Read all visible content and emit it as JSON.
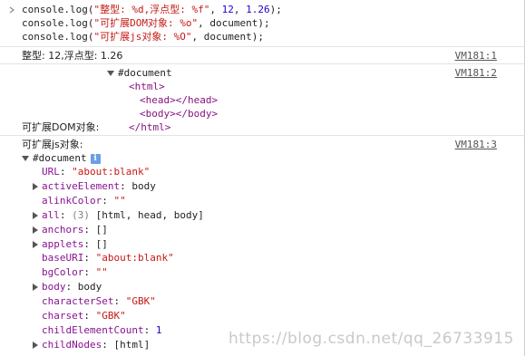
{
  "code": {
    "lines": [
      {
        "pre": "console.log(",
        "str": "\"整型: %d,浮点型: %f\"",
        "mid": ", ",
        "arg1": "12",
        "sep": ", ",
        "arg2": "1.26",
        "end": ");"
      },
      {
        "pre": "console.log(",
        "str": "\"可扩展DOM对象: %o\"",
        "rest": ", document);"
      },
      {
        "pre": "console.log(",
        "str": "\"可扩展js对象: %O\"",
        "rest": ", document);"
      }
    ]
  },
  "output1": {
    "text": "整型: 12,浮点型: 1.26",
    "source": "VM181:1"
  },
  "output2": {
    "label": "可扩展DOM对象:",
    "source": "VM181:2",
    "node": "#document",
    "tree": [
      "<html>",
      "<head></head>",
      "<body></body>",
      "</html>"
    ]
  },
  "output3": {
    "label": "可扩展js对象:",
    "source": "VM181:3",
    "node": "#document",
    "info_icon": "i",
    "props": [
      {
        "key": "URL",
        "value": "\"about:blank\"",
        "kind": "str",
        "expandable": false
      },
      {
        "key": "activeElement",
        "value": "body",
        "kind": "plain",
        "expandable": true
      },
      {
        "key": "alinkColor",
        "value": "\"\"",
        "kind": "str",
        "expandable": false
      },
      {
        "key": "all",
        "value": "(3) [html, head, body]",
        "kind": "plain",
        "expandable": true
      },
      {
        "key": "anchors",
        "value": "[]",
        "kind": "plain",
        "expandable": true
      },
      {
        "key": "applets",
        "value": "[]",
        "kind": "plain",
        "expandable": true
      },
      {
        "key": "baseURI",
        "value": "\"about:blank\"",
        "kind": "str",
        "expandable": false
      },
      {
        "key": "bgColor",
        "value": "\"\"",
        "kind": "str",
        "expandable": false
      },
      {
        "key": "body",
        "value": "body",
        "kind": "plain",
        "expandable": true
      },
      {
        "key": "characterSet",
        "value": "\"GBK\"",
        "kind": "str",
        "expandable": false
      },
      {
        "key": "charset",
        "value": "\"GBK\"",
        "kind": "str",
        "expandable": false
      },
      {
        "key": "childElementCount",
        "value": "1",
        "kind": "num",
        "expandable": false
      },
      {
        "key": "childNodes",
        "value": "[html]",
        "kind": "plain",
        "expandable": true
      }
    ]
  },
  "watermark": "https://blog.csdn.net/qq_26733915",
  "colors": {
    "string": "#c41a16",
    "number": "#1c00cf",
    "tag": "#881280",
    "property": "#881391",
    "info_icon": "#6b9ee9"
  }
}
